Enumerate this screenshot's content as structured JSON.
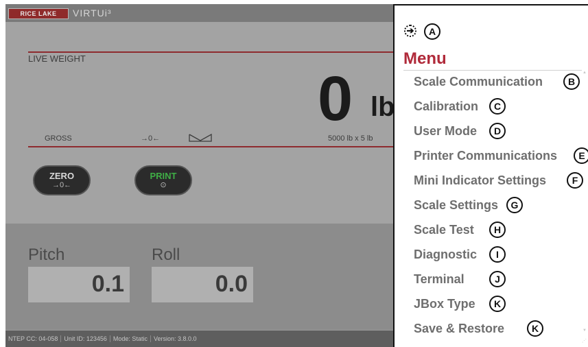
{
  "app": {
    "logo_text": "RICE LAKE",
    "brand": "VIRTUi³",
    "live_weight_title": "LIVE WEIGHT",
    "weight_value": "0",
    "weight_unit": "lb",
    "gross_label": "GROSS",
    "zero_indicator": "→0←",
    "capacity": "5000 lb x 5 lb",
    "zero_button": {
      "label": "ZERO",
      "symbol": "→0←"
    },
    "print_button": {
      "label": "PRINT",
      "symbol": "⊙"
    },
    "pitch": {
      "label": "Pitch",
      "value": "0.1"
    },
    "roll": {
      "label": "Roll",
      "value": "0.0"
    },
    "status": [
      "NTEP CC: 04-058",
      "Unit ID: 123456",
      "Mode: Static",
      "Version: 3.8.0.0"
    ]
  },
  "menu": {
    "back_icon": "arrow-right-circle-icon",
    "title": "Menu",
    "items": [
      {
        "label": "Scale Communication",
        "callout": "B"
      },
      {
        "label": "Calibration",
        "callout": "C"
      },
      {
        "label": "User Mode",
        "callout": "D"
      },
      {
        "label": "Printer Communications",
        "callout": "E"
      },
      {
        "label": "Mini Indicator Settings",
        "callout": "F"
      },
      {
        "label": "Scale Settings",
        "callout": "G"
      },
      {
        "label": "Scale Test",
        "callout": "H"
      },
      {
        "label": "Diagnostic",
        "callout": "I"
      },
      {
        "label": "Terminal",
        "callout": "J"
      },
      {
        "label": "JBox Type",
        "callout": "K"
      },
      {
        "label": "Save & Restore",
        "callout": "K"
      }
    ],
    "header_callout": "A"
  },
  "colors": {
    "menu_title": "#b02a3a",
    "accent_line": "#8e2a2e",
    "print_green": "#3fae46"
  }
}
